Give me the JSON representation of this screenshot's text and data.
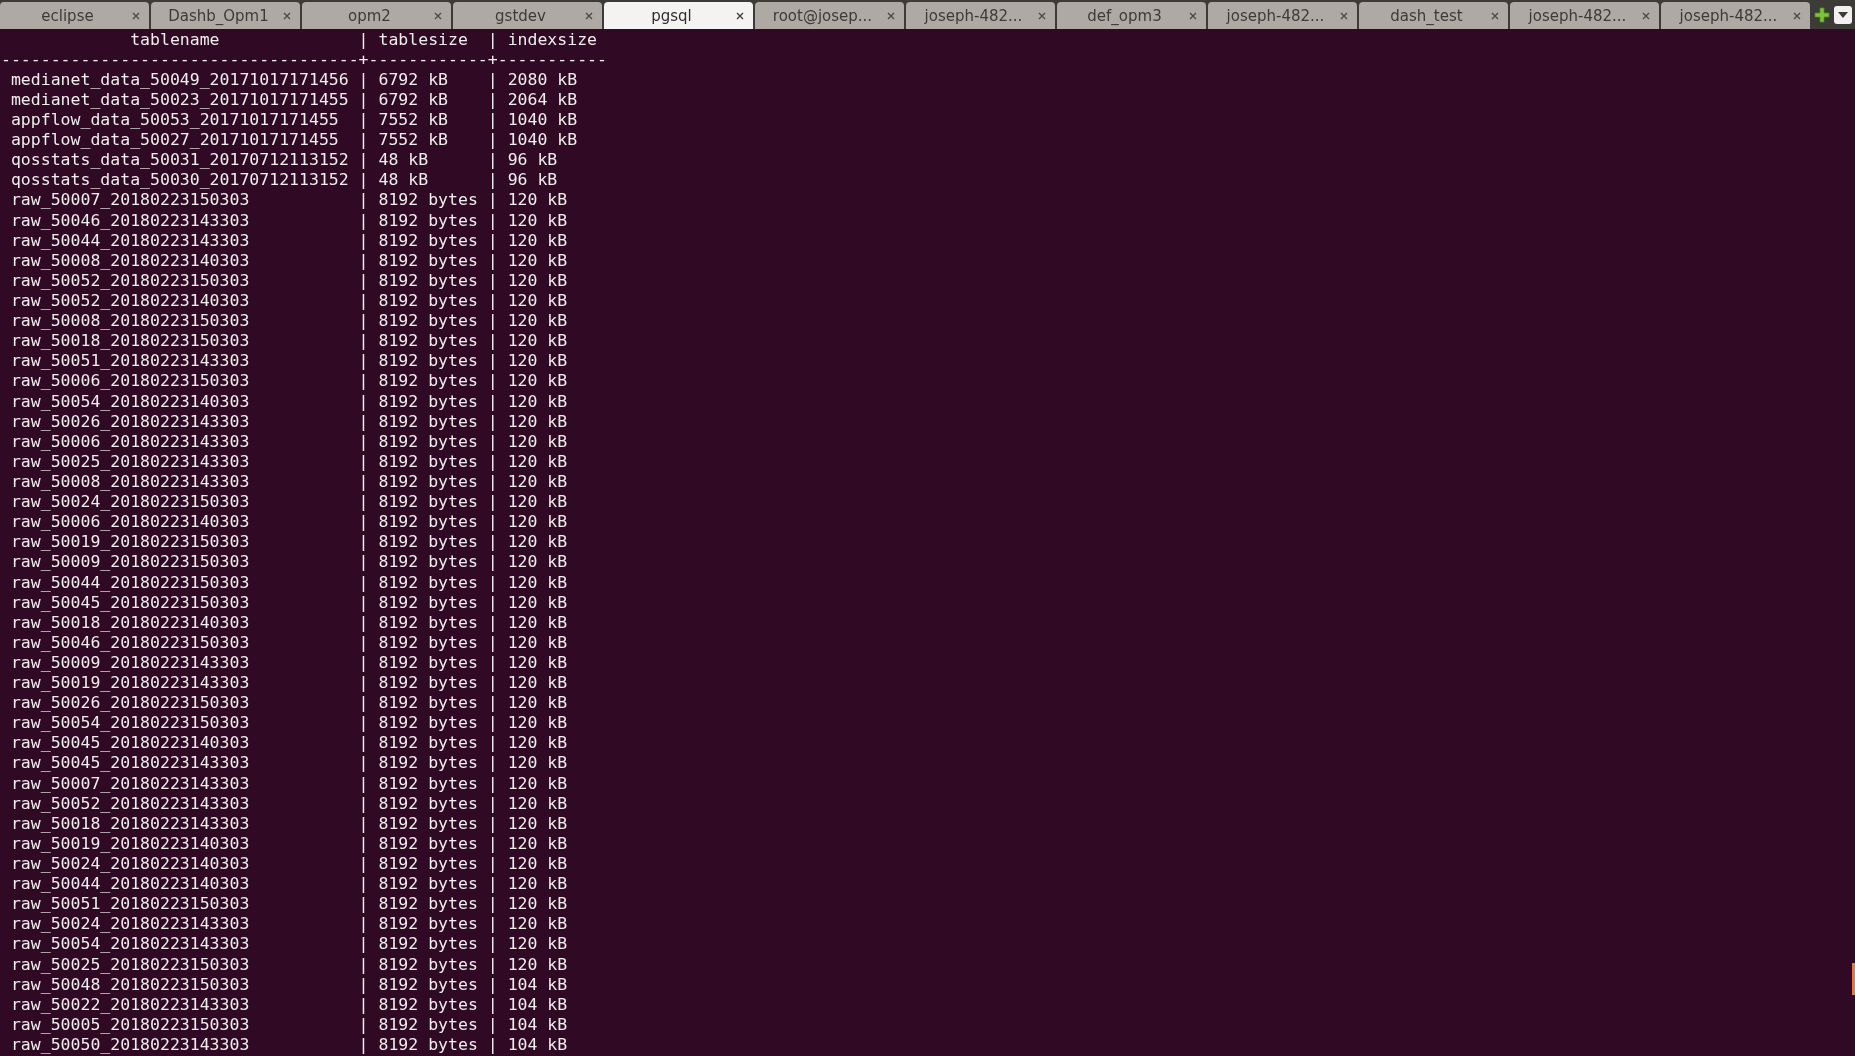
{
  "tabs": [
    {
      "label": "eclipse",
      "selected": false
    },
    {
      "label": "Dashb_Opm1",
      "selected": false
    },
    {
      "label": "opm2",
      "selected": false
    },
    {
      "label": "gstdev",
      "selected": false
    },
    {
      "label": "pgsql",
      "selected": true
    },
    {
      "label": "root@josep...",
      "selected": false
    },
    {
      "label": "joseph-482...",
      "selected": false
    },
    {
      "label": "def_opm3",
      "selected": false
    },
    {
      "label": "joseph-482...",
      "selected": false
    },
    {
      "label": "dash_test",
      "selected": false
    },
    {
      "label": "joseph-482...",
      "selected": false
    },
    {
      "label": "joseph-482...",
      "selected": false
    }
  ],
  "terminal": {
    "lines": [
      "             tablename              | tablesize  | indexsize",
      "------------------------------------+------------+-----------",
      " medianet_data_50049_20171017171456 | 6792 kB    | 2080 kB",
      " medianet_data_50023_20171017171455 | 6792 kB    | 2064 kB",
      " appflow_data_50053_20171017171455  | 7552 kB    | 1040 kB",
      " appflow_data_50027_20171017171455  | 7552 kB    | 1040 kB",
      " qosstats_data_50031_20170712113152 | 48 kB      | 96 kB",
      " qosstats_data_50030_20170712113152 | 48 kB      | 96 kB",
      " raw_50007_20180223150303           | 8192 bytes | 120 kB",
      " raw_50046_20180223143303           | 8192 bytes | 120 kB",
      " raw_50044_20180223143303           | 8192 bytes | 120 kB",
      " raw_50008_20180223140303           | 8192 bytes | 120 kB",
      " raw_50052_20180223150303           | 8192 bytes | 120 kB",
      " raw_50052_20180223140303           | 8192 bytes | 120 kB",
      " raw_50008_20180223150303           | 8192 bytes | 120 kB",
      " raw_50018_20180223150303           | 8192 bytes | 120 kB",
      " raw_50051_20180223143303           | 8192 bytes | 120 kB",
      " raw_50006_20180223150303           | 8192 bytes | 120 kB",
      " raw_50054_20180223140303           | 8192 bytes | 120 kB",
      " raw_50026_20180223143303           | 8192 bytes | 120 kB",
      " raw_50006_20180223143303           | 8192 bytes | 120 kB",
      " raw_50025_20180223143303           | 8192 bytes | 120 kB",
      " raw_50008_20180223143303           | 8192 bytes | 120 kB",
      " raw_50024_20180223150303           | 8192 bytes | 120 kB",
      " raw_50006_20180223140303           | 8192 bytes | 120 kB",
      " raw_50019_20180223150303           | 8192 bytes | 120 kB",
      " raw_50009_20180223150303           | 8192 bytes | 120 kB",
      " raw_50044_20180223150303           | 8192 bytes | 120 kB",
      " raw_50045_20180223150303           | 8192 bytes | 120 kB",
      " raw_50018_20180223140303           | 8192 bytes | 120 kB",
      " raw_50046_20180223150303           | 8192 bytes | 120 kB",
      " raw_50009_20180223143303           | 8192 bytes | 120 kB",
      " raw_50019_20180223143303           | 8192 bytes | 120 kB",
      " raw_50026_20180223150303           | 8192 bytes | 120 kB",
      " raw_50054_20180223150303           | 8192 bytes | 120 kB",
      " raw_50045_20180223140303           | 8192 bytes | 120 kB",
      " raw_50045_20180223143303           | 8192 bytes | 120 kB",
      " raw_50007_20180223143303           | 8192 bytes | 120 kB",
      " raw_50052_20180223143303           | 8192 bytes | 120 kB",
      " raw_50018_20180223143303           | 8192 bytes | 120 kB",
      " raw_50019_20180223140303           | 8192 bytes | 120 kB",
      " raw_50024_20180223140303           | 8192 bytes | 120 kB",
      " raw_50044_20180223140303           | 8192 bytes | 120 kB",
      " raw_50051_20180223150303           | 8192 bytes | 120 kB",
      " raw_50024_20180223143303           | 8192 bytes | 120 kB",
      " raw_50054_20180223143303           | 8192 bytes | 120 kB",
      " raw_50025_20180223150303           | 8192 bytes | 120 kB",
      " raw_50048_20180223150303           | 8192 bytes | 104 kB",
      " raw_50022_20180223143303           | 8192 bytes | 104 kB",
      " raw_50005_20180223150303           | 8192 bytes | 104 kB",
      " raw_50050_20180223143303           | 8192 bytes | 104 kB"
    ]
  }
}
